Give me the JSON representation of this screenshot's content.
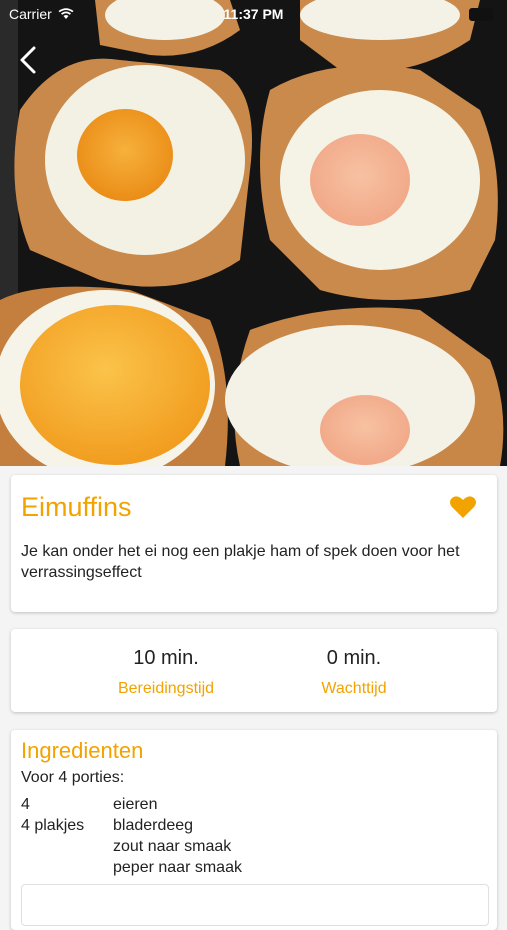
{
  "status_bar": {
    "carrier": "Carrier",
    "time": "11:37 PM"
  },
  "recipe": {
    "title": "Eimuffins",
    "description": "Je kan onder het ei nog een plakje ham of spek doen voor het verrassingseffect",
    "favorite": true
  },
  "times": {
    "prep_value": "10 min.",
    "prep_label": "Bereidingstijd",
    "wait_value": "0 min.",
    "wait_label": "Wachttijd"
  },
  "ingredients": {
    "title": "Ingredienten",
    "portions": "Voor 4 porties:",
    "items": [
      {
        "qty": "4",
        "name": "eieren"
      },
      {
        "qty": "4 plakjes",
        "name": "bladerdeeg"
      },
      {
        "qty": "",
        "name": "zout naar smaak"
      },
      {
        "qty": "",
        "name": "peper naar smaak"
      }
    ]
  },
  "colors": {
    "accent": "#f2a300",
    "background": "#f4f4f4",
    "card": "#ffffff"
  },
  "icons": {
    "back": "chevron-left-icon",
    "favorite": "heart-icon",
    "wifi": "wifi-icon"
  }
}
